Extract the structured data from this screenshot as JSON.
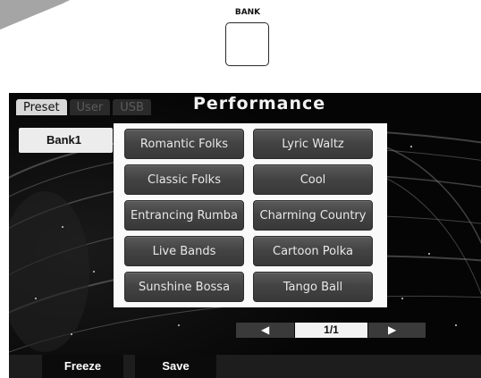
{
  "bank_panel": {
    "label": "BANK"
  },
  "screen": {
    "tabs": [
      {
        "label": "Preset",
        "active": true
      },
      {
        "label": "User",
        "active": false
      },
      {
        "label": "USB",
        "active": false
      }
    ],
    "title": "Performance",
    "bank_field": "Bank1",
    "songs": [
      "Romantic Folks",
      "Lyric Waltz",
      "Classic Folks",
      "Cool",
      "Entrancing Rumba",
      "Charming Country",
      "Live Bands",
      "Cartoon Polka",
      "Sunshine Bossa",
      "Tango Ball"
    ],
    "pager": {
      "prev_icon": "triangle-left-icon",
      "next_icon": "triangle-right-icon",
      "page": "1/1"
    },
    "footer": {
      "freeze_label": "Freeze",
      "save_label": "Save"
    }
  },
  "colors": {
    "screen_bg": "#070707",
    "button_gray": "#444444",
    "panel_white": "#fafafa"
  }
}
